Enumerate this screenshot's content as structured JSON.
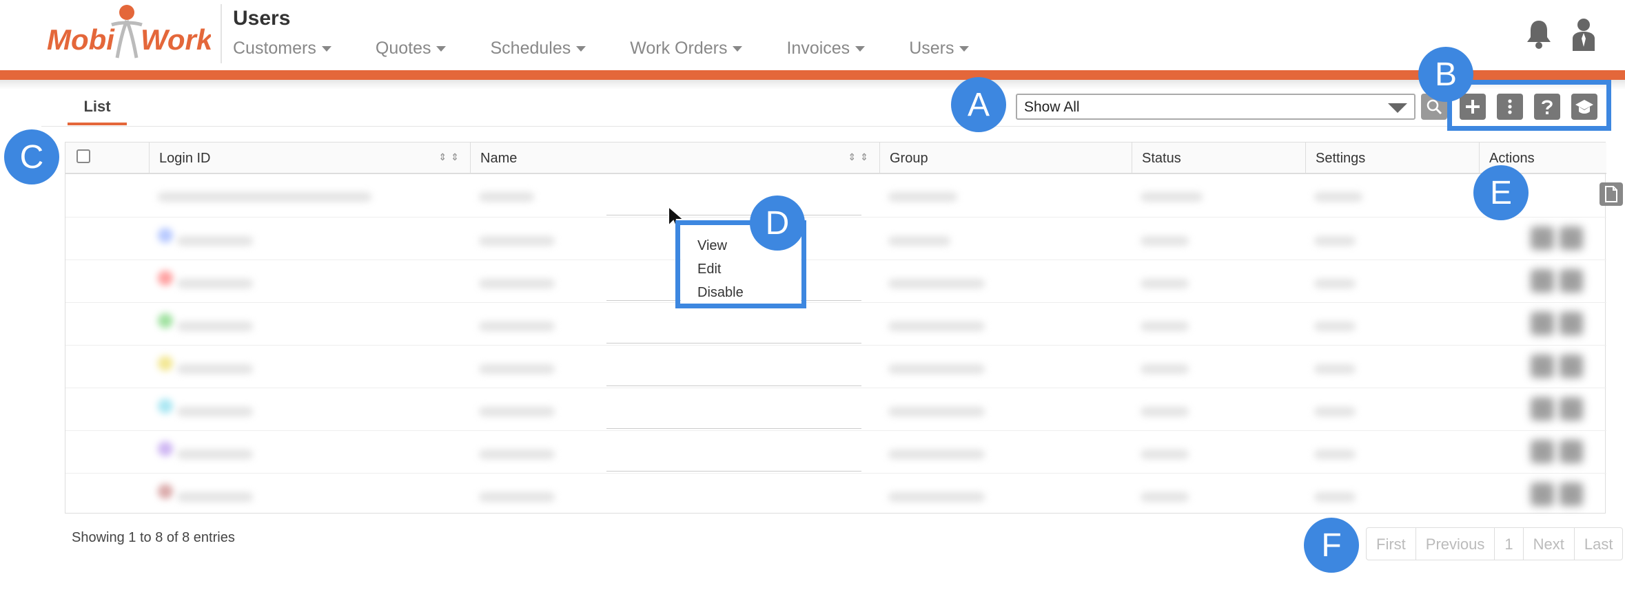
{
  "header": {
    "page_title": "Users",
    "nav": [
      {
        "label": "Customers"
      },
      {
        "label": "Quotes"
      },
      {
        "label": "Schedules"
      },
      {
        "label": "Work Orders"
      },
      {
        "label": "Invoices"
      },
      {
        "label": "Users"
      }
    ],
    "brand_color": "#e4673a"
  },
  "toolbar": {
    "tab_label": "List",
    "filter_value": "Show All"
  },
  "table": {
    "columns": [
      "Login ID",
      "Name",
      "Group",
      "Status",
      "Settings",
      "Actions"
    ]
  },
  "context_menu": {
    "items": [
      "View",
      "Edit",
      "Disable"
    ]
  },
  "footer": {
    "showing": "Showing 1 to 8 of 8 entries",
    "pager": [
      "First",
      "Previous",
      "1",
      "Next",
      "Last"
    ]
  },
  "callouts": [
    "A",
    "B",
    "C",
    "D",
    "E",
    "F"
  ],
  "callout_color": "#3d87e0",
  "icons": [
    "logo",
    "bell-icon",
    "user-icon",
    "search-icon",
    "plus-icon",
    "more-vertical-icon",
    "help-icon",
    "graduation-cap-icon",
    "document-icon",
    "cursor-icon"
  ]
}
